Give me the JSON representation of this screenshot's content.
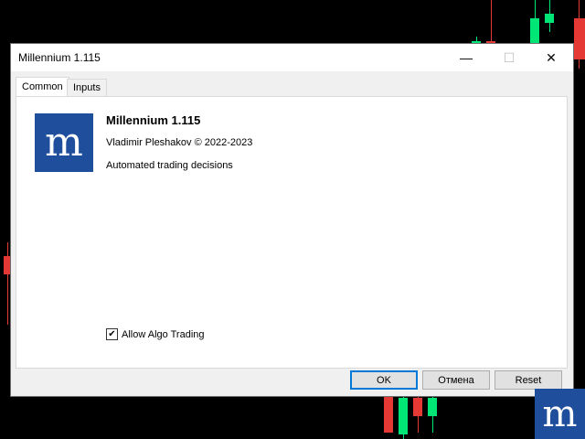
{
  "window": {
    "title": "Millennium 1.115",
    "minimize_glyph": "—",
    "maximize_glyph": "☐",
    "close_glyph": "✕"
  },
  "tabs": [
    {
      "label": "Common",
      "active": true
    },
    {
      "label": "Inputs",
      "active": false
    }
  ],
  "about": {
    "logo_letter": "m",
    "app_name": "Millennium 1.115",
    "author": "Vladimir Pleshakov © 2022-2023",
    "description": "Automated trading decisions"
  },
  "options": {
    "allow_algo_trading_label": "Allow Algo Trading",
    "allow_algo_trading_checked": true,
    "check_glyph": "✔"
  },
  "buttons": {
    "ok": "OK",
    "cancel": "Отмена",
    "reset": "Reset"
  },
  "colors": {
    "brand_blue": "#1f4f9c",
    "bull_candle": "#00e676",
    "bear_candle": "#e53935",
    "focus_border": "#0078d7"
  },
  "corner_logo": {
    "letter": "m"
  }
}
